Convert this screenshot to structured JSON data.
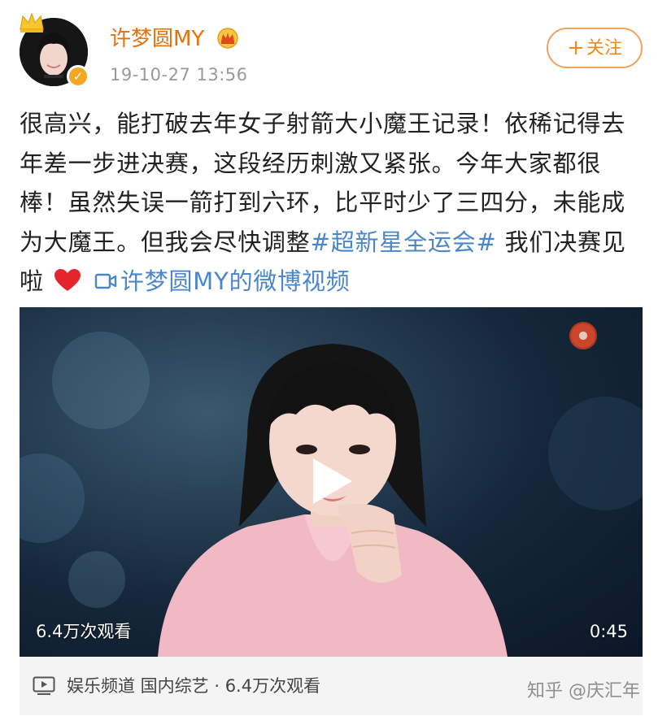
{
  "post": {
    "username": "许梦圆MY",
    "timestamp": "19-10-27 13:56",
    "follow_label": "关注",
    "text": "很高兴，能打破去年女子射箭大小魔王记录！依稀记得去年差一步进决赛，这段经历刺激又紧张。今年大家都很棒！虽然失误一箭打到六环，比平时少了三四分，未能成为大魔王。但我会尽快调整",
    "hashtag": "#超新星全运会#",
    "text_after": " 我们决赛见啦",
    "video_link": "许梦圆MY的微博视频"
  },
  "video": {
    "view_count": "6.4万次观看",
    "duration": "0:45",
    "meta": "娱乐频道 国内综艺 · 6.4万次观看"
  },
  "watermark": "知乎 @庆汇年",
  "icons": {
    "crown": "crown-icon",
    "verified": "verified-badge-icon",
    "vip": "vip-crown-icon",
    "heart": "heart-icon",
    "video_link": "video-link-icon",
    "play": "play-icon",
    "video_meta": "video-play-icon"
  },
  "colors": {
    "username": "#e8700a",
    "follow": "#f08a1d",
    "link": "#4a86c8",
    "heart": "#e4262c",
    "verified": "#f5a623"
  }
}
